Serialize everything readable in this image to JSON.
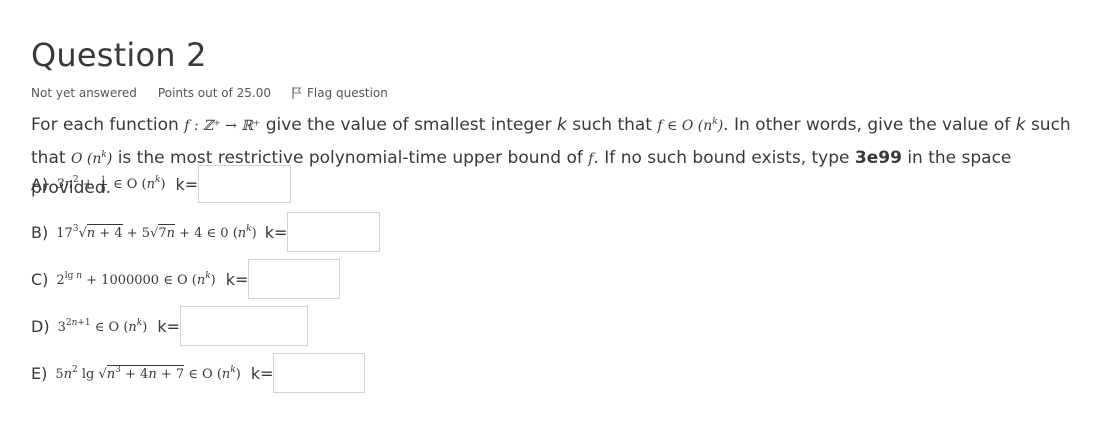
{
  "question": {
    "title": "Question 2",
    "status": "Not yet answered",
    "points": "Points out of 25.00",
    "flag_label": "Flag question"
  },
  "intro": {
    "p1": "For each function",
    "func": "f : ℤ⁺ → ℝ⁺",
    "p2": "give the value of smallest integer",
    "k1": "k",
    "p3": "such that",
    "cond": "f ∈ O (n",
    "p4": ". In other words, give the value of",
    "k2": "k",
    "p5": "such that",
    "cond2": "O (n",
    "p6": "is the most restrictive polynomial-time upper bound of",
    "f2": "f",
    "p7": ". If no such bound exists, type",
    "code": "3e99",
    "p8": "in the space provided."
  },
  "items": [
    {
      "letter": "A)",
      "k_label": "k=",
      "value": ""
    },
    {
      "letter": "B)",
      "k_label": "k=",
      "value": ""
    },
    {
      "letter": "C)",
      "k_label": "k=",
      "value": ""
    },
    {
      "letter": "D)",
      "k_label": "k=",
      "value": ""
    },
    {
      "letter": "E)",
      "k_label": "k=",
      "value": ""
    }
  ],
  "icons": {
    "flag": "flag-icon"
  }
}
